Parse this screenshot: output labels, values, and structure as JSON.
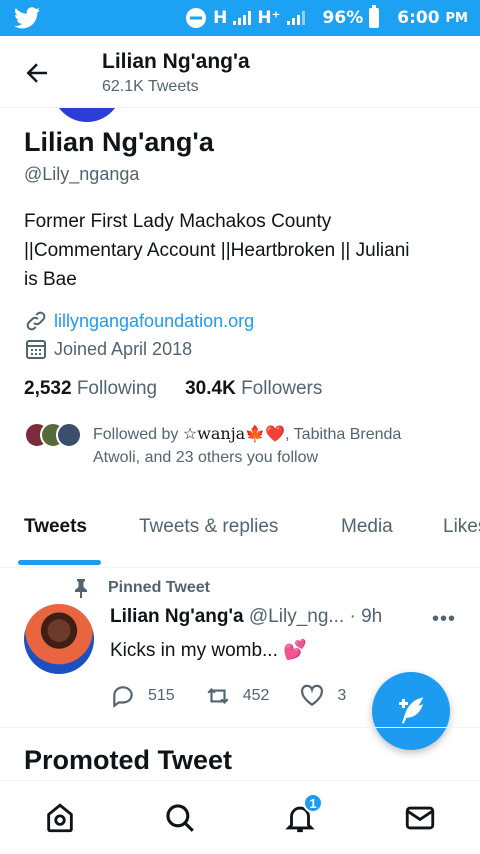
{
  "status_bar": {
    "network": "H",
    "network2": "H⁺",
    "battery": "96%",
    "time": "6:00",
    "ampm": "PM"
  },
  "header": {
    "name": "Lilian Ng'ang'a",
    "tweet_count": "62.1K Tweets"
  },
  "profile": {
    "name": "Lilian Ng'ang'a",
    "handle": "@Lily_nganga",
    "bio_lines": [
      "Former First Lady Machakos County",
      "||Commentary Account ||Heartbroken || Juliani",
      "is Bae"
    ],
    "website": "lillyngangafoundation.org",
    "joined": "Joined April 2018",
    "following_count": "2,532",
    "following_label": "Following",
    "followers_count": "30.4K",
    "followers_label": "Followers",
    "followed_by_prefix": "Followed by ",
    "followed_by_name": "☆wanja",
    "followed_by_emojis": "🍁❤️",
    "followed_by_rest": ", Tabitha Brenda",
    "followed_by_line2": "Atwoli, and 23 others you follow"
  },
  "tabs": [
    {
      "label": "Tweets",
      "active": true
    },
    {
      "label": "Tweets & replies",
      "active": false
    },
    {
      "label": "Media",
      "active": false
    },
    {
      "label": "Likes",
      "active": false
    }
  ],
  "tweet": {
    "pinned_label": "Pinned Tweet",
    "author": "Lilian Ng'ang'a",
    "handle_time": "@Lily_ng... · 9h",
    "text": "Kicks in my womb...",
    "emoji": "💕",
    "replies": "515",
    "retweets": "452",
    "likes": "3"
  },
  "promoted_heading": "Promoted Tweet",
  "notifications_badge": "1",
  "colors": {
    "brand": "#1da1f2",
    "accent": "#1d9bf0",
    "text": "#0f1419",
    "secondary": "#536471"
  }
}
